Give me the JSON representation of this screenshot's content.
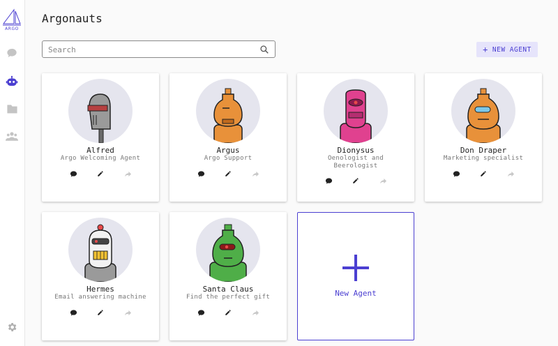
{
  "app": {
    "logo_text": "ARGO"
  },
  "sidebar": {
    "items": [
      {
        "name": "chat",
        "icon": "chat-bubble-icon",
        "active": false
      },
      {
        "name": "agents",
        "icon": "robot-icon",
        "active": true
      },
      {
        "name": "folders",
        "icon": "folder-icon",
        "active": false
      },
      {
        "name": "groups",
        "icon": "people-icon",
        "active": false
      }
    ],
    "settings_icon": "gear-icon"
  },
  "page": {
    "title": "Argonauts"
  },
  "search": {
    "placeholder": "Search",
    "value": ""
  },
  "toolbar": {
    "new_agent_label": "NEW AGENT"
  },
  "agents": [
    {
      "name": "Alfred",
      "description": "Argo Welcoming Agent",
      "avatar_color": "#9a9a9a"
    },
    {
      "name": "Argus",
      "description": "Argo Support",
      "avatar_color": "#e8913a"
    },
    {
      "name": "Dionysus",
      "description": "Oenologist and Beerologist",
      "avatar_color": "#e0418f"
    },
    {
      "name": "Don Draper",
      "description": "Marketing specialist",
      "avatar_color": "#e8913a"
    },
    {
      "name": "Hermes",
      "description": "Email answering machine",
      "avatar_color": "#e6e6e6"
    },
    {
      "name": "Santa Claus",
      "description": "Find the perfect gift",
      "avatar_color": "#4fae48"
    }
  ],
  "new_card": {
    "label": "New Agent"
  },
  "colors": {
    "accent": "#4b3fd1",
    "accent_light": "#e6e4fb",
    "avatar_bg": "#e5e5ee"
  }
}
